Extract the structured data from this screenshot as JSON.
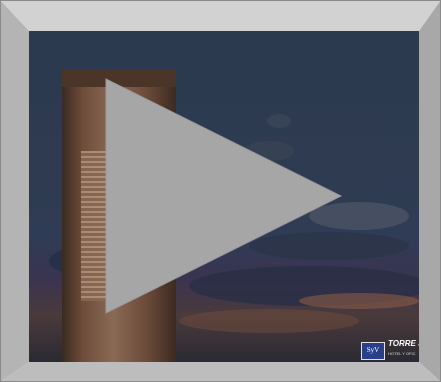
{
  "player": {
    "play_icon": "play-icon",
    "frame_color": "#c8c8c8",
    "play_color": "#a6a6a6"
  },
  "video": {
    "overlay_logo_text": "SyV",
    "overlay_title": "TORRE S",
    "overlay_subtitle": "HOTEL Y OFIC"
  }
}
